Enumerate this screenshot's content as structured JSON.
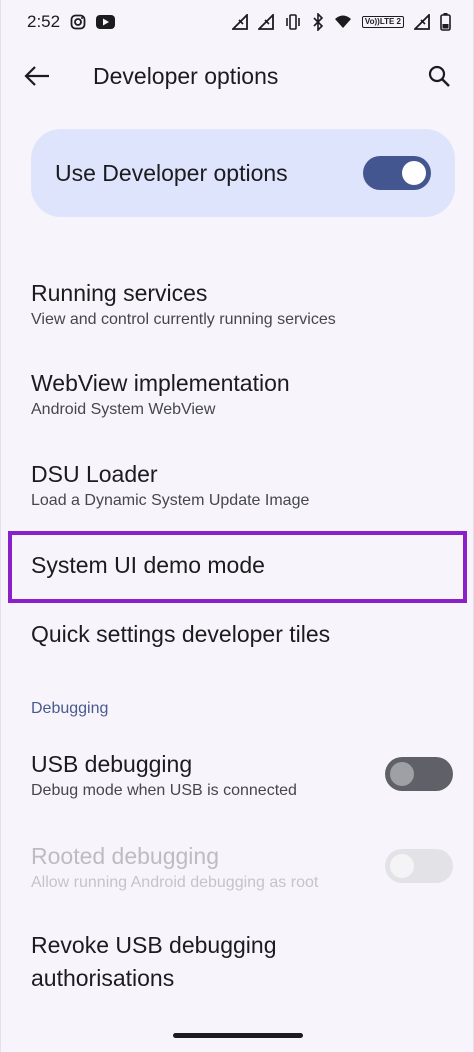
{
  "status_bar": {
    "time": "2:52",
    "left_icons": [
      "instagram-icon",
      "youtube-icon"
    ],
    "right_icons": [
      "signal-icon",
      "signal-icon",
      "vibrate-icon",
      "bluetooth-icon",
      "wifi-icon",
      "volte-icon",
      "signal-icon",
      "battery-icon"
    ],
    "volte_label_top": "Vo))",
    "volte_label_bottom": "LTE 2"
  },
  "app_bar": {
    "title": "Developer options",
    "back_icon": "arrow-back-icon",
    "search_icon": "search-icon"
  },
  "master_switch": {
    "label": "Use Developer options",
    "state": "on",
    "accent": "#44568f",
    "card_color": "#dde4fb"
  },
  "items": [
    {
      "title": "Running services",
      "subtitle": "View and control currently running services"
    },
    {
      "title": "WebView implementation",
      "subtitle": "Android System WebView"
    },
    {
      "title": "DSU Loader",
      "subtitle": "Load a Dynamic System Update Image"
    },
    {
      "title": "System UI demo mode",
      "highlighted": true,
      "highlight_color": "#8b20c9"
    },
    {
      "title": "Quick settings developer tiles"
    }
  ],
  "debugging": {
    "header": "Debugging",
    "items": [
      {
        "title": "USB debugging",
        "subtitle": "Debug mode when USB is connected",
        "toggle": "off"
      },
      {
        "title": "Rooted debugging",
        "subtitle": "Allow running Android debugging as root",
        "toggle": "off",
        "disabled": true
      },
      {
        "title_line1": "Revoke USB debugging",
        "title_line2": "authorisations"
      }
    ]
  }
}
